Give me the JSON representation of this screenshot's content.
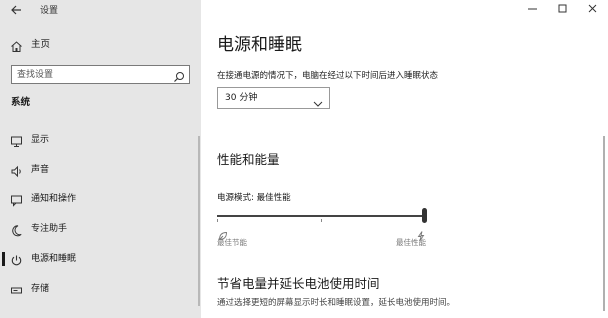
{
  "window": {
    "title": "设置"
  },
  "sidebar": {
    "home_label": "主页",
    "search_placeholder": "查找设置",
    "section": "系统",
    "items": [
      {
        "label": "显示",
        "icon": "monitor-icon"
      },
      {
        "label": "声音",
        "icon": "speaker-icon"
      },
      {
        "label": "通知和操作",
        "icon": "notification-icon"
      },
      {
        "label": "专注助手",
        "icon": "moon-icon"
      },
      {
        "label": "电源和睡眠",
        "icon": "power-icon",
        "selected": true
      },
      {
        "label": "存储",
        "icon": "storage-icon"
      }
    ]
  },
  "main": {
    "page_title": "电源和睡眠",
    "sleep_desc": "在接通电源的情况下，电脑在经过以下时间后进入睡眠状态",
    "sleep_value": "30 分钟",
    "perf_title": "性能和能量",
    "power_mode_label": "电源模式: 最佳性能",
    "power_mode_level": 1.0,
    "slider_left_label": "最佳节能",
    "slider_right_label": "最佳性能",
    "battery_title": "节省电量并延长电池使用时间",
    "battery_desc": "通过选择更短的屏幕显示时长和睡眠设置，延长电池使用时间。"
  },
  "colors": {
    "sidebar_bg": "#e6e6e6",
    "content_bg": "#ffffff",
    "text": "#1a1a1a"
  }
}
